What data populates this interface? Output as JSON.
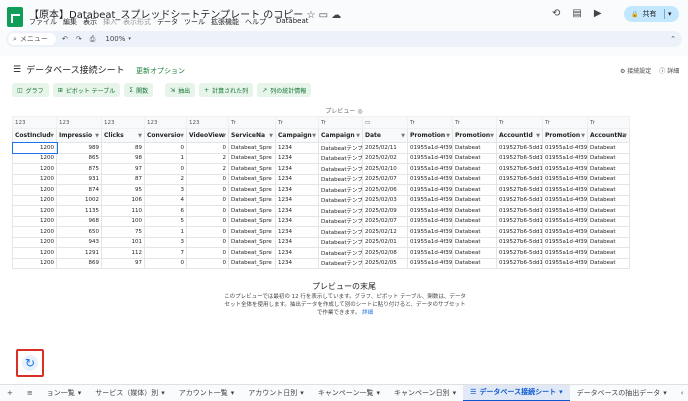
{
  "doc": {
    "title": "【原本】Databeat_スプレッドシートテンプレート のコピー",
    "star": "☆",
    "folder": "▭",
    "cloud": "☁"
  },
  "menu": [
    "ファイル",
    "編集",
    "表示",
    "挿入",
    "表示形式",
    "データ",
    "ツール",
    "拡張機能",
    "ヘルプ",
    "Databeat"
  ],
  "menu_disabled": [
    3,
    4
  ],
  "header_icons": {
    "history": "⟲",
    "comment": "▤",
    "camera": "▶"
  },
  "share": {
    "label": "共有",
    "lock": "🔒",
    "caret": "▾"
  },
  "toolbar": {
    "search": "メニュー",
    "undo": "↶",
    "redo": "↷",
    "print": "⎙",
    "zoom": "100%",
    "collapse": "⌃"
  },
  "panel": {
    "icon": "☰",
    "title": "データベース接続シート",
    "update": "更新オプション",
    "settings": "接続設定",
    "details": "詳細"
  },
  "actions": [
    {
      "icon": "◫",
      "label": "グラフ"
    },
    {
      "icon": "⊞",
      "label": "ピボット テーブル"
    },
    {
      "icon": "Σ",
      "label": "関数"
    },
    {
      "icon": "⇲",
      "label": "抽出"
    },
    {
      "icon": "+",
      "label": "計算された列"
    },
    {
      "icon": "↗",
      "label": "列の統計情報"
    }
  ],
  "preview_label": "プレビュー ◎",
  "table": {
    "types": [
      "123",
      "123",
      "123",
      "123",
      "123",
      "Tr",
      "Tr",
      "Tr",
      "▭",
      "Tr",
      "Tr",
      "Tr",
      "Tr",
      "Tr"
    ],
    "columns": [
      "CostInclud",
      "Impressio",
      "Clicks",
      "Conversio",
      "VideoView",
      "ServiceNa",
      "Campaign",
      "Campaign",
      "Date",
      "Promotion",
      "Promotion",
      "AccountId",
      "Promotion",
      "AccountNa"
    ],
    "rows": [
      [
        "1200",
        "989",
        "89",
        "0",
        "0",
        "Databeat_Spre",
        "1234",
        "Databeatテンプ",
        "2025/02/11",
        "01955a1d-4f39-",
        "Databeat",
        "019527b6-5dd1-",
        "01955a1d-4f39-",
        "Databeat"
      ],
      [
        "1200",
        "865",
        "98",
        "1",
        "2",
        "Databeat_Spre",
        "1234",
        "Databeatテンプ",
        "2025/02/02",
        "01955a1d-4f39-",
        "Databeat",
        "019527b6-5dd1-",
        "01955a1d-4f39-",
        "Databeat"
      ],
      [
        "1200",
        "875",
        "97",
        "0",
        "2",
        "Databeat_Spre",
        "1234",
        "Databeatテンプ",
        "2025/02/10",
        "01955a1d-4f39-",
        "Databeat",
        "019527b6-5dd1-",
        "01955a1d-4f39-",
        "Databeat"
      ],
      [
        "1200",
        "931",
        "87",
        "2",
        "0",
        "Databeat_Spre",
        "1234",
        "Databeatテンプ",
        "2025/02/07",
        "01955a1d-4f39-",
        "Databeat",
        "019527b6-5dd1-",
        "01955a1d-4f39-",
        "Databeat"
      ],
      [
        "1200",
        "874",
        "95",
        "3",
        "0",
        "Databeat_Spre",
        "1234",
        "Databeatテンプ",
        "2025/02/06",
        "01955a1d-4f39-",
        "Databeat",
        "019527b6-5dd1-",
        "01955a1d-4f39-",
        "Databeat"
      ],
      [
        "1200",
        "1002",
        "106",
        "4",
        "0",
        "Databeat_Spre",
        "1234",
        "Databeatテンプ",
        "2025/02/03",
        "01955a1d-4f39-",
        "Databeat",
        "019527b6-5dd1-",
        "01955a1d-4f39-",
        "Databeat"
      ],
      [
        "1200",
        "1135",
        "110",
        "6",
        "0",
        "Databeat_Spre",
        "1234",
        "Databeatテンプ",
        "2025/02/09",
        "01955a1d-4f39-",
        "Databeat",
        "019527b6-5dd1-",
        "01955a1d-4f39-",
        "Databeat"
      ],
      [
        "1200",
        "968",
        "100",
        "5",
        "0",
        "Databeat_Spre",
        "1234",
        "Databeatテンプ",
        "2025/02/07",
        "01955a1d-4f39-",
        "Databeat",
        "019527b6-5dd1-",
        "01955a1d-4f39-",
        "Databeat"
      ],
      [
        "1200",
        "650",
        "75",
        "1",
        "0",
        "Databeat_Spre",
        "1234",
        "Databeatテンプ",
        "2025/02/12",
        "01955a1d-4f39-",
        "Databeat",
        "019527b6-5dd1-",
        "01955a1d-4f39-",
        "Databeat"
      ],
      [
        "1200",
        "943",
        "101",
        "3",
        "0",
        "Databeat_Spre",
        "1234",
        "Databeatテンプ",
        "2025/02/01",
        "01955a1d-4f39-",
        "Databeat",
        "019527b6-5dd1-",
        "01955a1d-4f39-",
        "Databeat"
      ],
      [
        "1200",
        "1291",
        "112",
        "7",
        "0",
        "Databeat_Spre",
        "1234",
        "Databeatテンプ",
        "2025/02/08",
        "01955a1d-4f39-",
        "Databeat",
        "019527b6-5dd1-",
        "01955a1d-4f39-",
        "Databeat"
      ],
      [
        "1200",
        "869",
        "97",
        "0",
        "0",
        "Databeat_Spre",
        "1234",
        "Databeatテンプ",
        "2025/02/05",
        "01955a1d-4f39-",
        "Databeat",
        "019527b6-5dd1-",
        "01955a1d-4f39-",
        "Databeat"
      ]
    ]
  },
  "end": {
    "title": "プレビューの末尾",
    "desc": "このプレビューでは最初の 12 行を表示しています。グラフ、ピボット テーブル、関数は、データ セット全体を使用します。抽出データを作成して別のシートに貼り付けると、データのサブセットで作業できます。",
    "link": "詳細"
  },
  "refresh_icon": "↻",
  "tabs": {
    "add": "+",
    "all": "≡",
    "items": [
      "ョン一覧",
      "サービス（媒体）別",
      "アカウント一覧",
      "アカウント日別",
      "キャンペーン一覧",
      "キャンペーン日別",
      "データベース接続シート",
      "データベースの抽出データ"
    ],
    "active": 6,
    "caret": "▾",
    "prev": "‹",
    "next": "›"
  },
  "colors": {
    "accent": "#0b57d0",
    "green": "#188038",
    "share_bg": "#c2e7ff",
    "highlight": "#d93025"
  }
}
